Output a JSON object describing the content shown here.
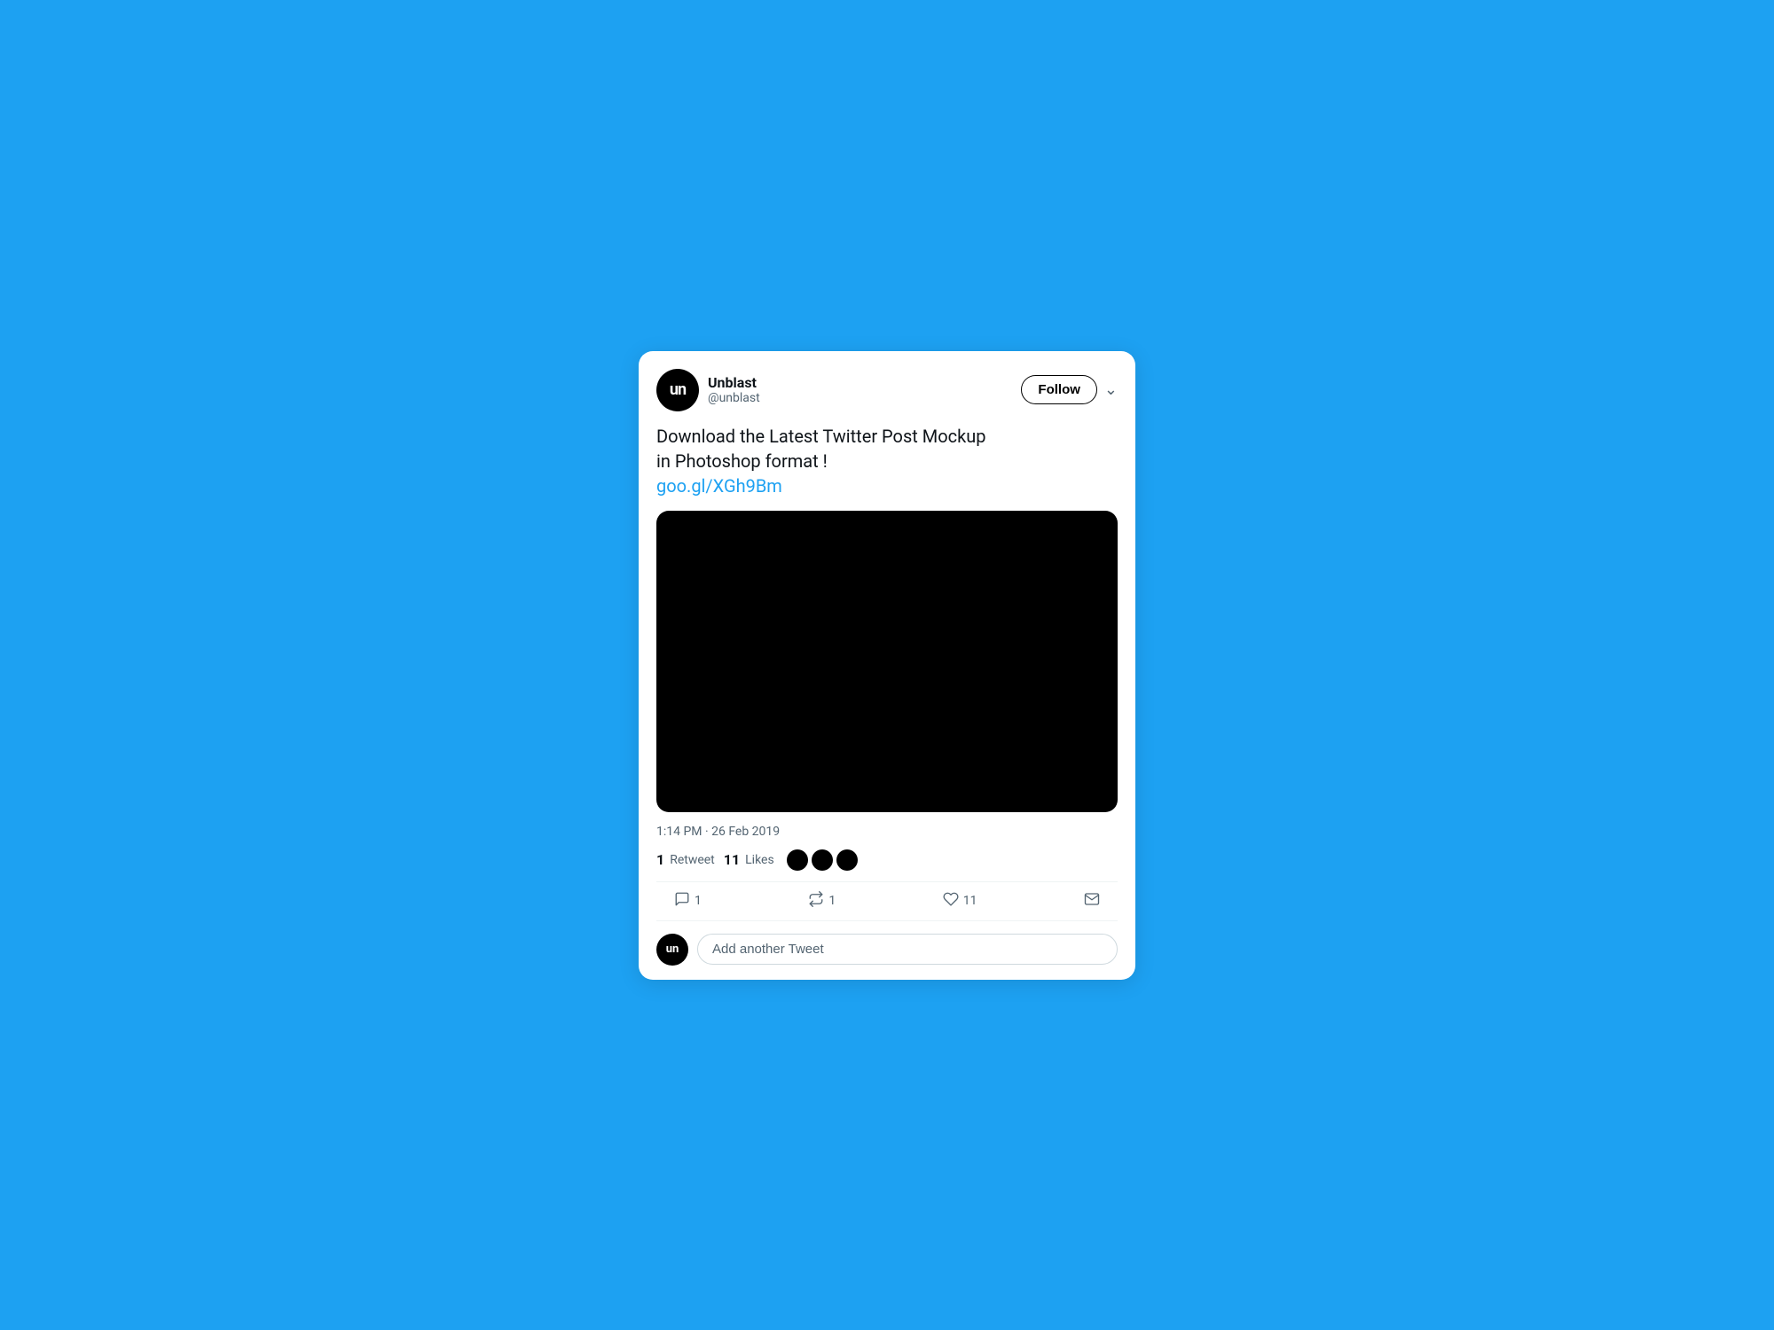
{
  "background": {
    "color": "#1DA1F2"
  },
  "tweet": {
    "user": {
      "name": "Unblast",
      "handle": "@unblast",
      "avatar_initials": "un"
    },
    "follow_button": "Follow",
    "text_line1": "Download the Latest Twitter Post Mockup",
    "text_line2": "in Photoshop format !",
    "text_link": "goo.gl/XGh9Bm",
    "timestamp": "1:14 PM · 26 Feb 2019",
    "stats": {
      "retweet_count": "1",
      "retweet_label": "Retweet",
      "likes_count": "11",
      "likes_label": "Likes"
    },
    "actions": {
      "reply_count": "1",
      "retweet_count": "1",
      "like_count": "11"
    },
    "reply_placeholder": "Add another Tweet"
  }
}
